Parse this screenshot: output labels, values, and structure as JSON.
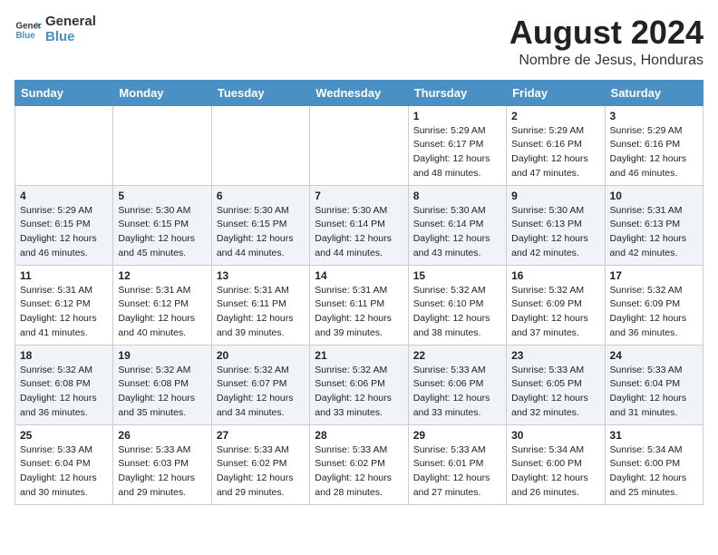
{
  "header": {
    "logo_line1": "General",
    "logo_line2": "Blue",
    "month_year": "August 2024",
    "location": "Nombre de Jesus, Honduras"
  },
  "weekdays": [
    "Sunday",
    "Monday",
    "Tuesday",
    "Wednesday",
    "Thursday",
    "Friday",
    "Saturday"
  ],
  "weeks": [
    [
      {
        "day": "",
        "info": ""
      },
      {
        "day": "",
        "info": ""
      },
      {
        "day": "",
        "info": ""
      },
      {
        "day": "",
        "info": ""
      },
      {
        "day": "1",
        "info": "Sunrise: 5:29 AM\nSunset: 6:17 PM\nDaylight: 12 hours\nand 48 minutes."
      },
      {
        "day": "2",
        "info": "Sunrise: 5:29 AM\nSunset: 6:16 PM\nDaylight: 12 hours\nand 47 minutes."
      },
      {
        "day": "3",
        "info": "Sunrise: 5:29 AM\nSunset: 6:16 PM\nDaylight: 12 hours\nand 46 minutes."
      }
    ],
    [
      {
        "day": "4",
        "info": "Sunrise: 5:29 AM\nSunset: 6:15 PM\nDaylight: 12 hours\nand 46 minutes."
      },
      {
        "day": "5",
        "info": "Sunrise: 5:30 AM\nSunset: 6:15 PM\nDaylight: 12 hours\nand 45 minutes."
      },
      {
        "day": "6",
        "info": "Sunrise: 5:30 AM\nSunset: 6:15 PM\nDaylight: 12 hours\nand 44 minutes."
      },
      {
        "day": "7",
        "info": "Sunrise: 5:30 AM\nSunset: 6:14 PM\nDaylight: 12 hours\nand 44 minutes."
      },
      {
        "day": "8",
        "info": "Sunrise: 5:30 AM\nSunset: 6:14 PM\nDaylight: 12 hours\nand 43 minutes."
      },
      {
        "day": "9",
        "info": "Sunrise: 5:30 AM\nSunset: 6:13 PM\nDaylight: 12 hours\nand 42 minutes."
      },
      {
        "day": "10",
        "info": "Sunrise: 5:31 AM\nSunset: 6:13 PM\nDaylight: 12 hours\nand 42 minutes."
      }
    ],
    [
      {
        "day": "11",
        "info": "Sunrise: 5:31 AM\nSunset: 6:12 PM\nDaylight: 12 hours\nand 41 minutes."
      },
      {
        "day": "12",
        "info": "Sunrise: 5:31 AM\nSunset: 6:12 PM\nDaylight: 12 hours\nand 40 minutes."
      },
      {
        "day": "13",
        "info": "Sunrise: 5:31 AM\nSunset: 6:11 PM\nDaylight: 12 hours\nand 39 minutes."
      },
      {
        "day": "14",
        "info": "Sunrise: 5:31 AM\nSunset: 6:11 PM\nDaylight: 12 hours\nand 39 minutes."
      },
      {
        "day": "15",
        "info": "Sunrise: 5:32 AM\nSunset: 6:10 PM\nDaylight: 12 hours\nand 38 minutes."
      },
      {
        "day": "16",
        "info": "Sunrise: 5:32 AM\nSunset: 6:09 PM\nDaylight: 12 hours\nand 37 minutes."
      },
      {
        "day": "17",
        "info": "Sunrise: 5:32 AM\nSunset: 6:09 PM\nDaylight: 12 hours\nand 36 minutes."
      }
    ],
    [
      {
        "day": "18",
        "info": "Sunrise: 5:32 AM\nSunset: 6:08 PM\nDaylight: 12 hours\nand 36 minutes."
      },
      {
        "day": "19",
        "info": "Sunrise: 5:32 AM\nSunset: 6:08 PM\nDaylight: 12 hours\nand 35 minutes."
      },
      {
        "day": "20",
        "info": "Sunrise: 5:32 AM\nSunset: 6:07 PM\nDaylight: 12 hours\nand 34 minutes."
      },
      {
        "day": "21",
        "info": "Sunrise: 5:32 AM\nSunset: 6:06 PM\nDaylight: 12 hours\nand 33 minutes."
      },
      {
        "day": "22",
        "info": "Sunrise: 5:33 AM\nSunset: 6:06 PM\nDaylight: 12 hours\nand 33 minutes."
      },
      {
        "day": "23",
        "info": "Sunrise: 5:33 AM\nSunset: 6:05 PM\nDaylight: 12 hours\nand 32 minutes."
      },
      {
        "day": "24",
        "info": "Sunrise: 5:33 AM\nSunset: 6:04 PM\nDaylight: 12 hours\nand 31 minutes."
      }
    ],
    [
      {
        "day": "25",
        "info": "Sunrise: 5:33 AM\nSunset: 6:04 PM\nDaylight: 12 hours\nand 30 minutes."
      },
      {
        "day": "26",
        "info": "Sunrise: 5:33 AM\nSunset: 6:03 PM\nDaylight: 12 hours\nand 29 minutes."
      },
      {
        "day": "27",
        "info": "Sunrise: 5:33 AM\nSunset: 6:02 PM\nDaylight: 12 hours\nand 29 minutes."
      },
      {
        "day": "28",
        "info": "Sunrise: 5:33 AM\nSunset: 6:02 PM\nDaylight: 12 hours\nand 28 minutes."
      },
      {
        "day": "29",
        "info": "Sunrise: 5:33 AM\nSunset: 6:01 PM\nDaylight: 12 hours\nand 27 minutes."
      },
      {
        "day": "30",
        "info": "Sunrise: 5:34 AM\nSunset: 6:00 PM\nDaylight: 12 hours\nand 26 minutes."
      },
      {
        "day": "31",
        "info": "Sunrise: 5:34 AM\nSunset: 6:00 PM\nDaylight: 12 hours\nand 25 minutes."
      }
    ]
  ]
}
